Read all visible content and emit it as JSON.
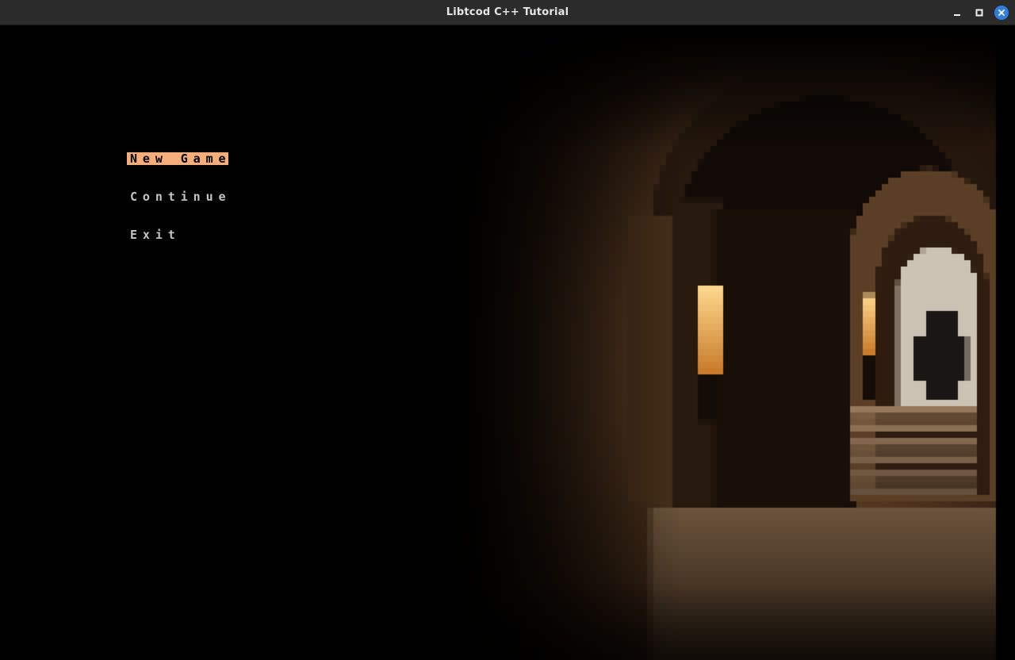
{
  "window": {
    "title": "Libtcod C++ Tutorial",
    "controls": [
      "minimize-icon",
      "maximize-icon",
      "close-icon"
    ],
    "accent_color": "#2f7fe0"
  },
  "menu": {
    "items": [
      {
        "label": "New Game",
        "selected": true
      },
      {
        "label": "Continue",
        "selected": false
      },
      {
        "label": "Exit",
        "selected": false
      }
    ],
    "highlight_color": "#f5ae7a",
    "text_color": "#c4c4c4"
  },
  "background": {
    "description_icon": "pixelated-dungeon-corridor-image"
  }
}
